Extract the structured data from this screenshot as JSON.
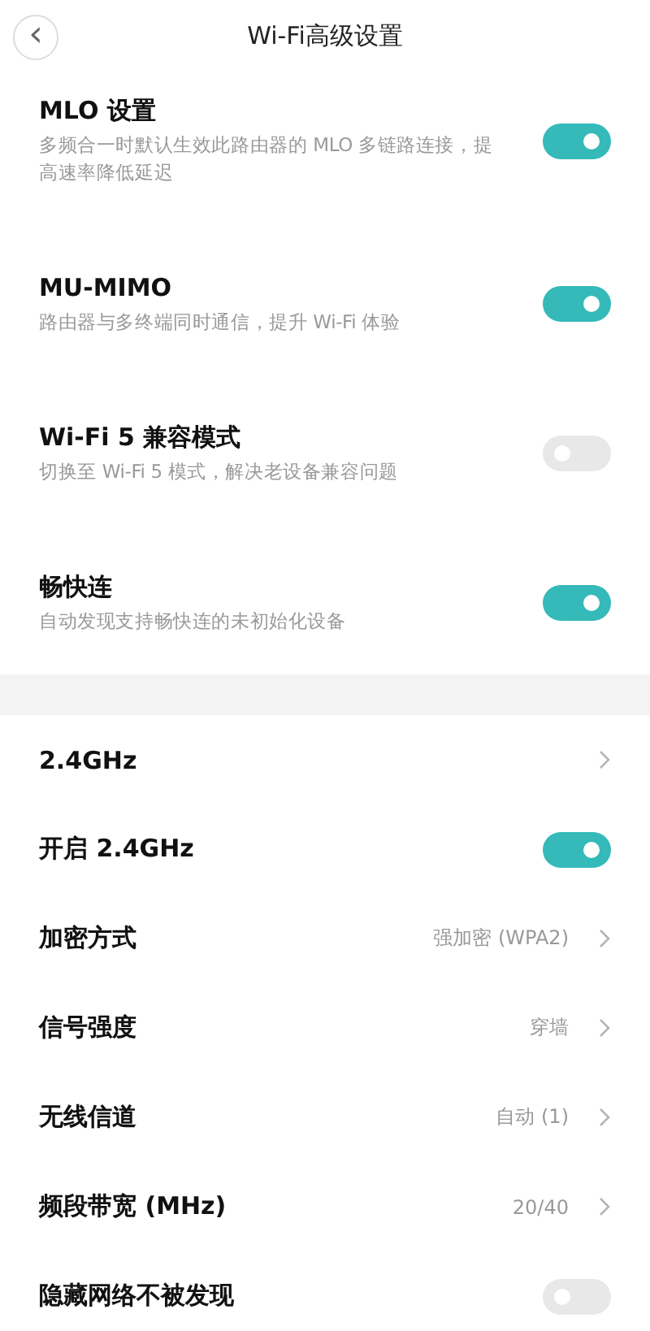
{
  "header": {
    "back": "‹",
    "title": "Wi-Fi高级设置"
  },
  "features": [
    {
      "title": "MLO 设置",
      "description": "多频合一时默认生效此路由器的 MLO 多链路连接，提高速率降低延迟",
      "on": true
    },
    {
      "title": "MU-MIMO",
      "description": "路由器与多终端同时通信，提升 Wi-Fi 体验",
      "on": true
    },
    {
      "title": "Wi-Fi 5 兼容模式",
      "description": "切换至 Wi-Fi 5 模式，解决老设备兼容问题",
      "on": false
    },
    {
      "title": "畅快连",
      "description": "自动发现支持畅快连的未初始化设备",
      "on": true
    }
  ],
  "band_settings": [
    {
      "kind": "link",
      "label": "2.4GHz"
    },
    {
      "kind": "toggle",
      "label": "开启 2.4GHz",
      "on": true
    },
    {
      "kind": "link",
      "label": "加密方式",
      "value": "强加密 (WPA2)"
    },
    {
      "kind": "link",
      "label": "信号强度",
      "value": "穿墙"
    },
    {
      "kind": "link",
      "label": "无线信道",
      "value": "自动 (1)"
    },
    {
      "kind": "link",
      "label": "频段带宽 (MHz)",
      "value": "20/40"
    },
    {
      "kind": "toggle",
      "label": "隐藏网络不被发现",
      "on": false
    }
  ]
}
